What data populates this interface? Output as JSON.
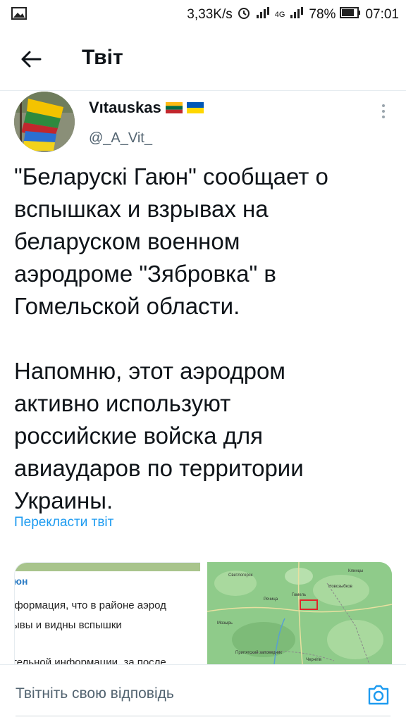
{
  "status_bar": {
    "net_speed": "3,33K/s",
    "network_type": "4G",
    "battery": "78%",
    "time": "07:01",
    "icons": [
      "image-icon",
      "alarm-icon",
      "signal-icon",
      "battery-icon"
    ]
  },
  "header": {
    "title": "Твіт",
    "back_icon": "arrow-left-icon"
  },
  "tweet": {
    "author_name": "Vıtauskas",
    "author_flags": [
      "lithuania-flag",
      "ukraine-flag"
    ],
    "handle": "@_A_Vit_",
    "text": "\"Беларускі Гаюн\" сообщает о\nвспышках и взрывах на\nбеларуском военном\nаэродроме \"Зябровка\" в\nГомельской области.\n\nНапомню, этот аэродром\nактивно используют\nроссийские войска для\nавиаударов по территории\nУкраины.",
    "translate_label": "Перекласти твіт"
  },
  "media": {
    "left": {
      "title": "юн",
      "lines": [
        "іформация, что в районе аэрод",
        "ывы и видны вспышки",
        "тельной информации, за после"
      ]
    },
    "right": {
      "labels": [
        "Светлогорск",
        "Гомель",
        "Речица",
        "Новозыбков",
        "Клинцы",
        "Мозырь",
        "Припятский заповедник",
        "Чернігів"
      ]
    }
  },
  "reply": {
    "placeholder": "Твітніть свою відповідь",
    "camera_icon": "camera-icon"
  },
  "colors": {
    "link": "#1d9bf0",
    "secondary_text": "#536471",
    "map_green": "#8fcb8a",
    "highlight_box": "#e0242a"
  }
}
